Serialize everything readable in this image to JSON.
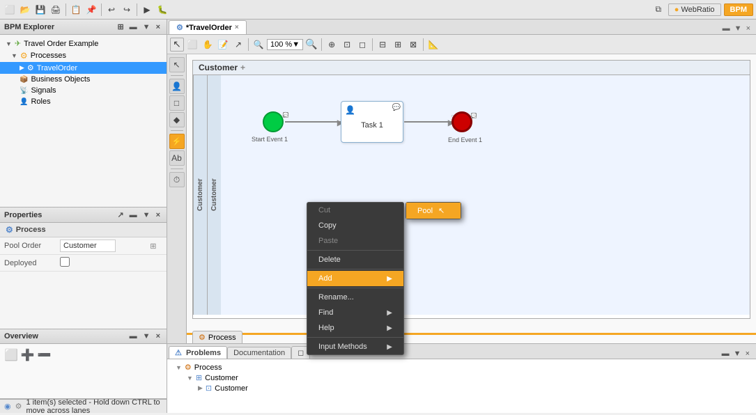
{
  "app": {
    "title": "WebRatio BPM",
    "webratio_label": "WebRatio",
    "bpm_label": "BPM"
  },
  "top_toolbar": {
    "icons": [
      "⬜",
      "💾",
      "📋",
      "↩",
      "↪",
      "🔧"
    ]
  },
  "bpm_explorer": {
    "title": "BPM Explorer",
    "root_item": "Travel Order Example",
    "processes_label": "Processes",
    "travel_order_label": "TravelOrder",
    "business_objects_label": "Business Objects",
    "signals_label": "Signals",
    "roles_label": "Roles"
  },
  "tab": {
    "label": "*TravelOrder",
    "close": "×"
  },
  "zoom": {
    "value": "100 %"
  },
  "pool": {
    "name": "Customer",
    "lane_label": "Customer",
    "lane2_label": "Customer"
  },
  "bpmn": {
    "start_event_label": "Start Event 1",
    "task_label": "Task 1",
    "end_event_label": "End Event 1"
  },
  "properties": {
    "title": "Properties",
    "process_label": "Process",
    "pool_order_label": "Pool Order",
    "pool_order_value": "Customer",
    "deployed_label": "Deployed"
  },
  "overview": {
    "title": "Overview"
  },
  "bottom_tabs": {
    "problems_label": "Problems",
    "documentation_label": "Documentation"
  },
  "bottom_tree": {
    "process_label": "Process",
    "customer1_label": "Customer",
    "customer2_label": "Customer"
  },
  "context_menu": {
    "cut_label": "Cut",
    "copy_label": "Copy",
    "paste_label": "Paste",
    "delete_label": "Delete",
    "add_label": "Add",
    "rename_label": "Rename...",
    "find_label": "Find",
    "help_label": "Help",
    "input_methods_label": "Input Methods"
  },
  "pool_submenu": {
    "pool_label": "Pool"
  },
  "status_bar": {
    "message": "1 item(s) selected - Hold down CTRL to move across lanes"
  },
  "editor_tab_bottom": {
    "process_label": "Process"
  }
}
